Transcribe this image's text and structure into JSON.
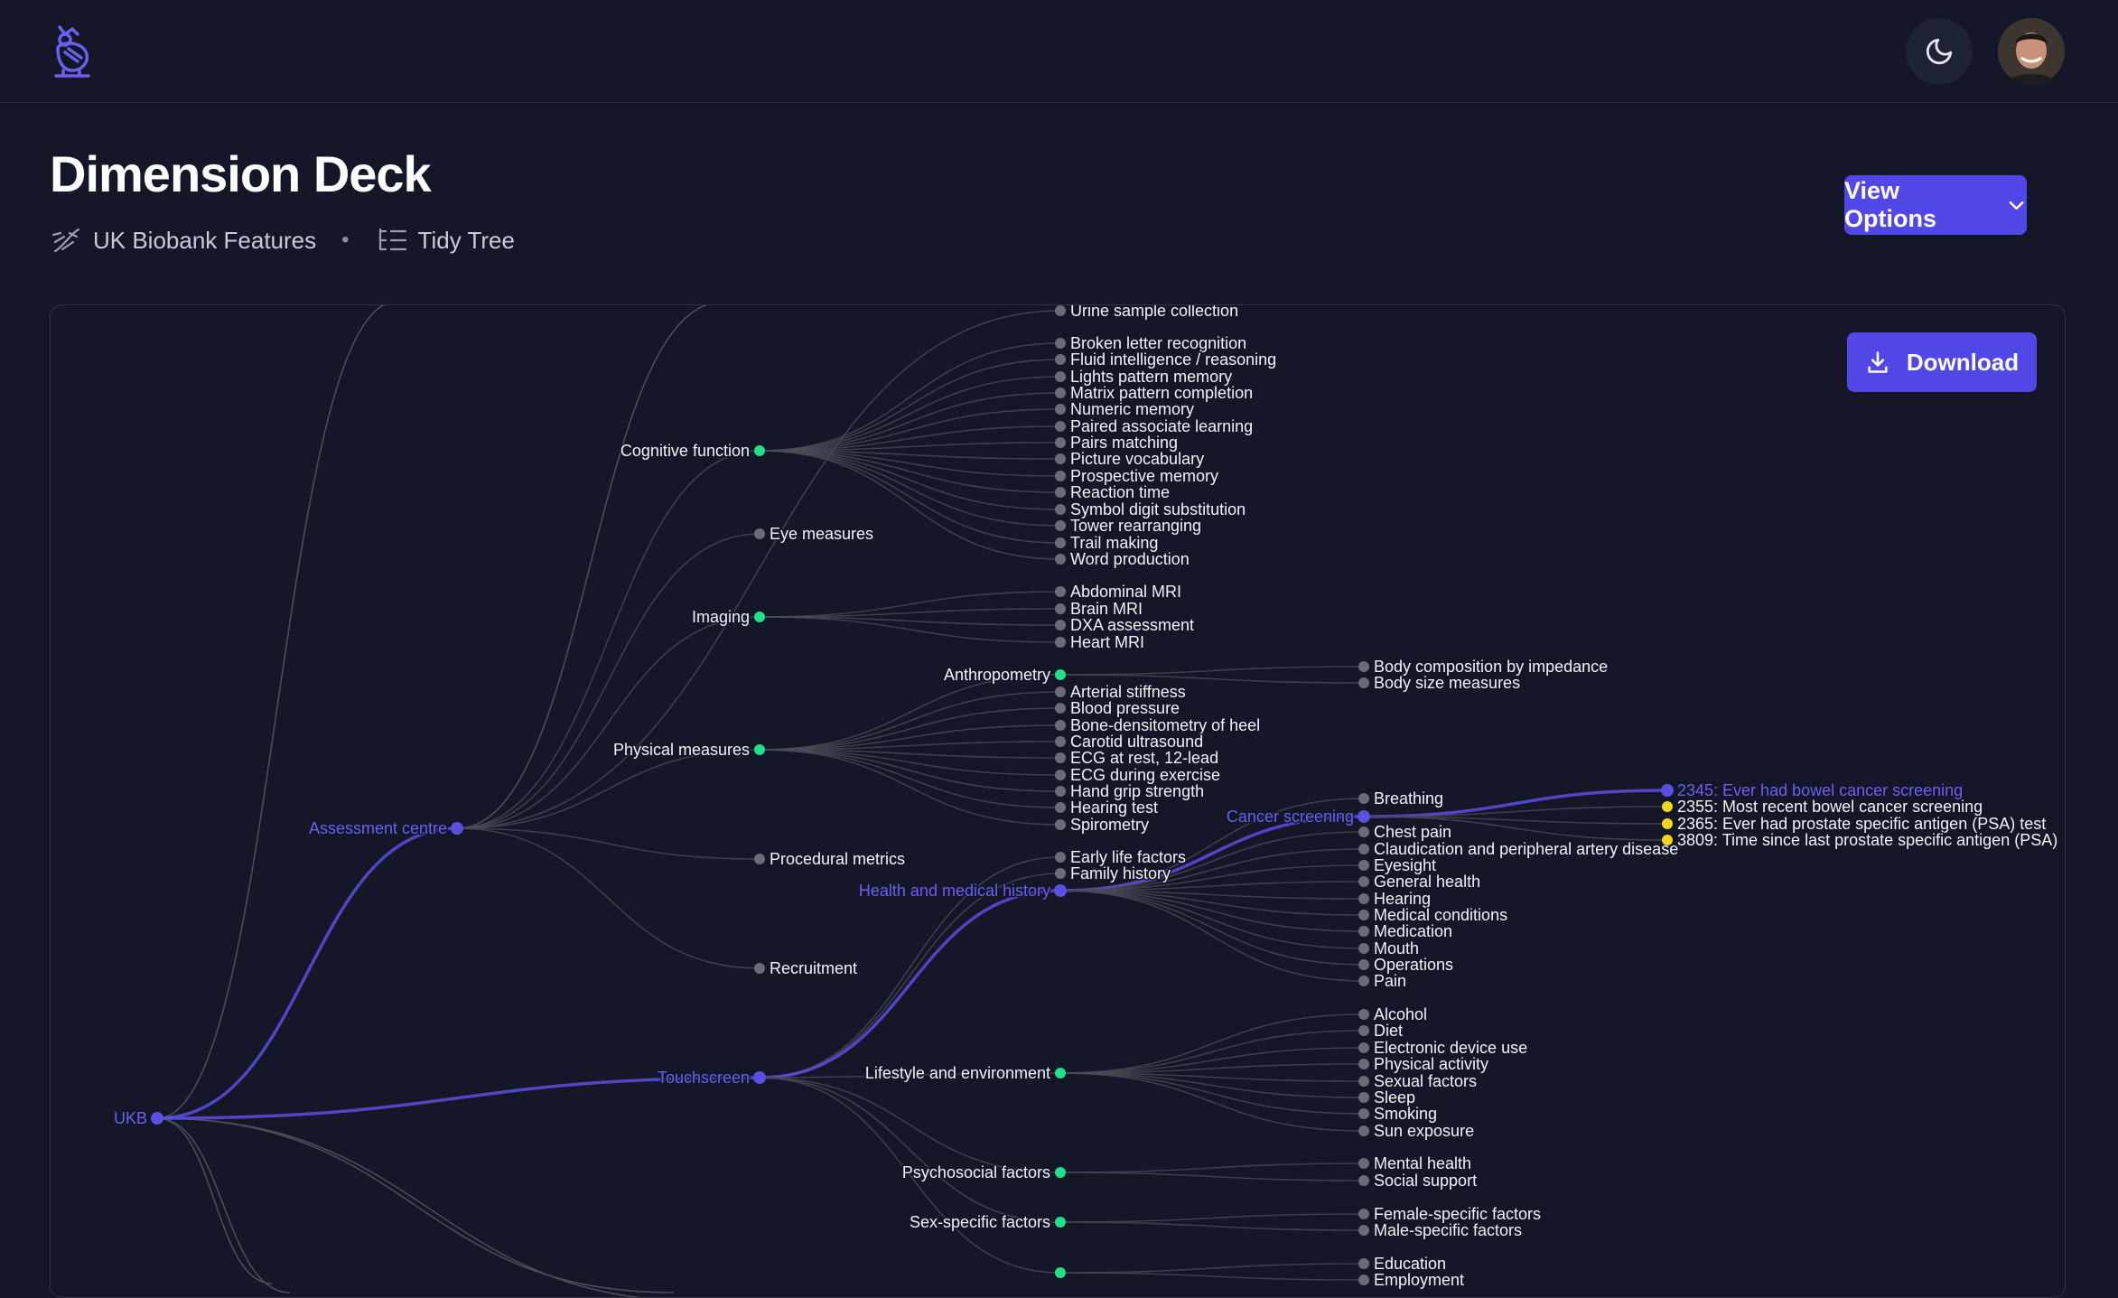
{
  "page": {
    "title": "Dimension Deck",
    "breadcrumb": {
      "dataset": "UK Biobank Features",
      "separator": "•",
      "view": "Tidy Tree"
    },
    "view_options_label": "View Options",
    "download_label": "Download"
  },
  "icons": {
    "logo": "owl-logo-icon",
    "theme": "moon-icon",
    "dataset": "dna-icon",
    "view": "list-tree-icon",
    "dropdown": "chevron-down-icon",
    "download": "download-icon"
  },
  "colors": {
    "background": "#131728",
    "accent": "#5147e6",
    "highlight": "#5a4fe0",
    "expanded_node": "#22e08a",
    "leaf_node": "#6b6b75",
    "selected_leaf": "#f3d51e",
    "link": "#4a4d57"
  },
  "tree": {
    "nodes": [
      {
        "id": "ukb",
        "label": "UKB",
        "state": "highlight"
      },
      {
        "id": "ac",
        "label": "Assessment centre",
        "state": "highlight",
        "parent": "ukb"
      },
      {
        "id": "ts",
        "label": "Touchscreen",
        "state": "highlight",
        "parent": "ukb"
      },
      {
        "id": "usc",
        "label": "Urine sample collection",
        "state": "leaf",
        "parent": "ac"
      },
      {
        "id": "cf",
        "label": "Cognitive function",
        "state": "expanded",
        "parent": "ac"
      },
      {
        "id": "eye",
        "label": "Eye measures",
        "state": "leaf",
        "parent": "ac"
      },
      {
        "id": "img",
        "label": "Imaging",
        "state": "expanded",
        "parent": "ac"
      },
      {
        "id": "pm",
        "label": "Physical measures",
        "state": "expanded",
        "parent": "ac"
      },
      {
        "id": "proc",
        "label": "Procedural metrics",
        "state": "leaf",
        "parent": "ac"
      },
      {
        "id": "rec",
        "label": "Recruitment",
        "state": "leaf",
        "parent": "ac"
      },
      {
        "id": "cf1",
        "label": "Broken letter recognition",
        "state": "leaf",
        "parent": "cf"
      },
      {
        "id": "cf2",
        "label": "Fluid intelligence / reasoning",
        "state": "leaf",
        "parent": "cf"
      },
      {
        "id": "cf3",
        "label": "Lights pattern memory",
        "state": "leaf",
        "parent": "cf"
      },
      {
        "id": "cf4",
        "label": "Matrix pattern completion",
        "state": "leaf",
        "parent": "cf"
      },
      {
        "id": "cf5",
        "label": "Numeric memory",
        "state": "leaf",
        "parent": "cf"
      },
      {
        "id": "cf6",
        "label": "Paired associate learning",
        "state": "leaf",
        "parent": "cf"
      },
      {
        "id": "cf7",
        "label": "Pairs matching",
        "state": "leaf",
        "parent": "cf"
      },
      {
        "id": "cf8",
        "label": "Picture vocabulary",
        "state": "leaf",
        "parent": "cf"
      },
      {
        "id": "cf9",
        "label": "Prospective memory",
        "state": "leaf",
        "parent": "cf"
      },
      {
        "id": "cf10",
        "label": "Reaction time",
        "state": "leaf",
        "parent": "cf"
      },
      {
        "id": "cf11",
        "label": "Symbol digit substitution",
        "state": "leaf",
        "parent": "cf"
      },
      {
        "id": "cf12",
        "label": "Tower rearranging",
        "state": "leaf",
        "parent": "cf"
      },
      {
        "id": "cf13",
        "label": "Trail making",
        "state": "leaf",
        "parent": "cf"
      },
      {
        "id": "cf14",
        "label": "Word production",
        "state": "leaf",
        "parent": "cf"
      },
      {
        "id": "img1",
        "label": "Abdominal MRI",
        "state": "leaf",
        "parent": "img"
      },
      {
        "id": "img2",
        "label": "Brain MRI",
        "state": "leaf",
        "parent": "img"
      },
      {
        "id": "img3",
        "label": "DXA assessment",
        "state": "leaf",
        "parent": "img"
      },
      {
        "id": "img4",
        "label": "Heart MRI",
        "state": "leaf",
        "parent": "img"
      },
      {
        "id": "anth",
        "label": "Anthropometry",
        "state": "expanded",
        "parent": "pm"
      },
      {
        "id": "pm1",
        "label": "Arterial stiffness",
        "state": "leaf",
        "parent": "pm"
      },
      {
        "id": "pm2",
        "label": "Blood pressure",
        "state": "leaf",
        "parent": "pm"
      },
      {
        "id": "pm3",
        "label": "Bone-densitometry of heel",
        "state": "leaf",
        "parent": "pm"
      },
      {
        "id": "pm4",
        "label": "Carotid ultrasound",
        "state": "leaf",
        "parent": "pm"
      },
      {
        "id": "pm5",
        "label": "ECG at rest, 12-lead",
        "state": "leaf",
        "parent": "pm"
      },
      {
        "id": "pm6",
        "label": "ECG during exercise",
        "state": "leaf",
        "parent": "pm"
      },
      {
        "id": "pm7",
        "label": "Hand grip strength",
        "state": "leaf",
        "parent": "pm"
      },
      {
        "id": "pm8",
        "label": "Hearing test",
        "state": "leaf",
        "parent": "pm"
      },
      {
        "id": "pm9",
        "label": "Spirometry",
        "state": "leaf",
        "parent": "pm"
      },
      {
        "id": "an1",
        "label": "Body composition by impedance",
        "state": "leaf",
        "parent": "anth"
      },
      {
        "id": "an2",
        "label": "Body size measures",
        "state": "leaf",
        "parent": "anth"
      },
      {
        "id": "elf",
        "label": "Early life factors",
        "state": "leaf",
        "parent": "ts"
      },
      {
        "id": "fh",
        "label": "Family history",
        "state": "leaf",
        "parent": "ts"
      },
      {
        "id": "hmh",
        "label": "Health and medical history",
        "state": "highlight",
        "parent": "ts"
      },
      {
        "id": "le",
        "label": "Lifestyle and environment",
        "state": "expanded",
        "parent": "ts"
      },
      {
        "id": "psy",
        "label": "Psychosocial factors",
        "state": "expanded",
        "parent": "ts"
      },
      {
        "id": "sex",
        "label": "Sex-specific factors",
        "state": "expanded",
        "parent": "ts"
      },
      {
        "id": "soc",
        "label": "",
        "state": "expanded",
        "parent": "ts"
      },
      {
        "id": "br",
        "label": "Breathing",
        "state": "leaf",
        "parent": "hmh"
      },
      {
        "id": "cs",
        "label": "Cancer screening",
        "state": "highlight",
        "parent": "hmh"
      },
      {
        "id": "h1",
        "label": "Chest pain",
        "state": "leaf",
        "parent": "hmh"
      },
      {
        "id": "h2",
        "label": "Claudication and peripheral artery disease",
        "state": "leaf",
        "parent": "hmh"
      },
      {
        "id": "h3",
        "label": "Eyesight",
        "state": "leaf",
        "parent": "hmh"
      },
      {
        "id": "h4",
        "label": "General health",
        "state": "leaf",
        "parent": "hmh"
      },
      {
        "id": "h5",
        "label": "Hearing",
        "state": "leaf",
        "parent": "hmh"
      },
      {
        "id": "h6",
        "label": "Medical conditions",
        "state": "leaf",
        "parent": "hmh"
      },
      {
        "id": "h7",
        "label": "Medication",
        "state": "leaf",
        "parent": "hmh"
      },
      {
        "id": "h8",
        "label": "Mouth",
        "state": "leaf",
        "parent": "hmh"
      },
      {
        "id": "h9",
        "label": "Operations",
        "state": "leaf",
        "parent": "hmh"
      },
      {
        "id": "h10",
        "label": "Pain",
        "state": "leaf",
        "parent": "hmh"
      },
      {
        "id": "cs1",
        "label": "2345: Ever had bowel cancer screening",
        "state": "hl-leaf",
        "parent": "cs"
      },
      {
        "id": "cs2",
        "label": "2355: Most recent bowel cancer screening",
        "state": "selected",
        "parent": "cs"
      },
      {
        "id": "cs3",
        "label": "2365: Ever had prostate specific antigen (PSA) test",
        "state": "selected",
        "parent": "cs"
      },
      {
        "id": "cs4",
        "label": "3809: Time since last prostate specific antigen (PSA)",
        "state": "selected",
        "parent": "cs"
      },
      {
        "id": "le1",
        "label": "Alcohol",
        "state": "leaf",
        "parent": "le"
      },
      {
        "id": "le2",
        "label": "Diet",
        "state": "leaf",
        "parent": "le"
      },
      {
        "id": "le3",
        "label": "Electronic device use",
        "state": "leaf",
        "parent": "le"
      },
      {
        "id": "le4",
        "label": "Physical activity",
        "state": "leaf",
        "parent": "le"
      },
      {
        "id": "le5",
        "label": "Sexual factors",
        "state": "leaf",
        "parent": "le"
      },
      {
        "id": "le6",
        "label": "Sleep",
        "state": "leaf",
        "parent": "le"
      },
      {
        "id": "le7",
        "label": "Smoking",
        "state": "leaf",
        "parent": "le"
      },
      {
        "id": "le8",
        "label": "Sun exposure",
        "state": "leaf",
        "parent": "le"
      },
      {
        "id": "ps1",
        "label": "Mental health",
        "state": "leaf",
        "parent": "psy"
      },
      {
        "id": "ps2",
        "label": "Social support",
        "state": "leaf",
        "parent": "psy"
      },
      {
        "id": "sx1",
        "label": "Female-specific factors",
        "state": "leaf",
        "parent": "sex"
      },
      {
        "id": "sx2",
        "label": "Male-specific factors",
        "state": "leaf",
        "parent": "sex"
      },
      {
        "id": "so1",
        "label": "Education",
        "state": "leaf",
        "parent": "soc"
      },
      {
        "id": "so2",
        "label": "Employment",
        "state": "leaf",
        "parent": "soc"
      }
    ],
    "stub_links": [
      {
        "from": "ukb",
        "count": 4
      }
    ]
  }
}
